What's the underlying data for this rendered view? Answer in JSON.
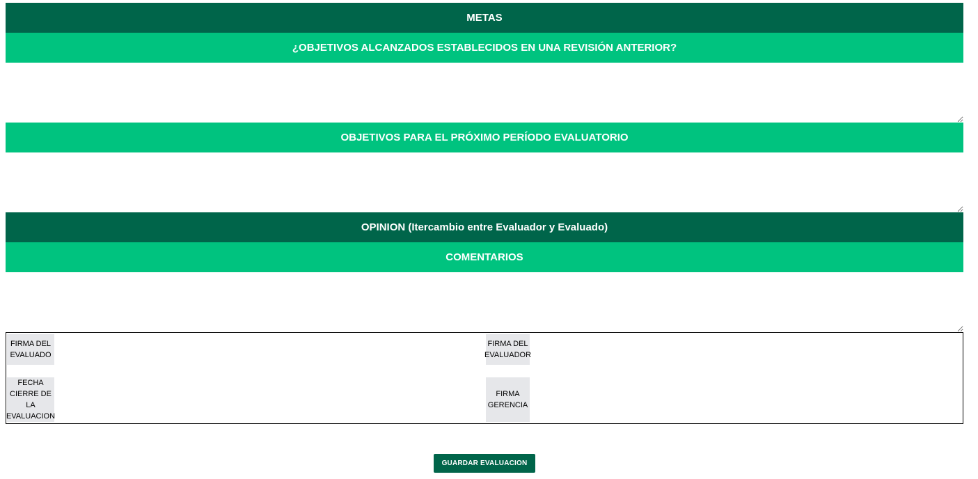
{
  "metas": {
    "title": "METAS",
    "prev_objectives": {
      "title": "¿OBJETIVOS ALCANZADOS ESTABLECIDOS EN UNA REVISIÓN ANTERIOR?",
      "value": ""
    },
    "next_objectives": {
      "title": "OBJETIVOS PARA EL PRÓXIMO PERÍODO EVALUATORIO",
      "value": ""
    }
  },
  "opinion": {
    "title": "OPINION (Itercambio entre Evaluador y Evaluado)",
    "comments": {
      "title": "COMENTARIOS",
      "value": ""
    }
  },
  "signatures": {
    "evaluado_label": "FIRMA DEL EVALUADO",
    "evaluador_label": "FIRMA DEL EVALUADOR",
    "fecha_cierre_label": "FECHA CIERRE DE LA EVALUACION",
    "gerencia_label": "FIRMA GERENCIA"
  },
  "actions": {
    "save_label": "GUARDAR EVALUACION"
  },
  "colors": {
    "dark_green": "#00654a",
    "light_green": "#00c37f",
    "label_bg": "#e6e7ea"
  }
}
